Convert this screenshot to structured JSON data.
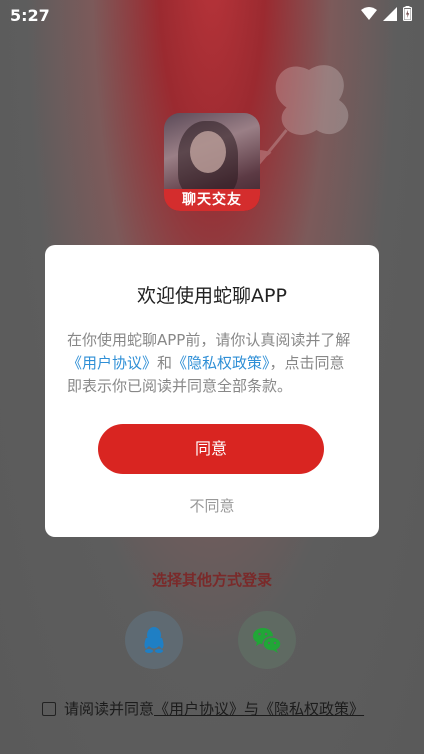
{
  "status": {
    "time": "5:27"
  },
  "logo": {
    "label": "聊天交友"
  },
  "dialog": {
    "title": "欢迎使用蛇聊APP",
    "body_pre": "在你使用蛇聊APP前，请你认真阅读并了解",
    "user_agreement": "《用户协议》",
    "and": "和",
    "privacy_policy": "《隐私权政策》",
    "body_post": "，点击同意即表示你已阅读并同意全部条款。",
    "agree": "同意",
    "disagree": "不同意"
  },
  "login": {
    "other_title": "选择其他方式登录",
    "agreement_pre": "请阅读并同意",
    "agreement_user": "《用户协议》",
    "agreement_and": "与",
    "agreement_privacy": "《隐私权政策》"
  },
  "colors": {
    "accent": "#d92521",
    "link": "#2f8fd6"
  }
}
